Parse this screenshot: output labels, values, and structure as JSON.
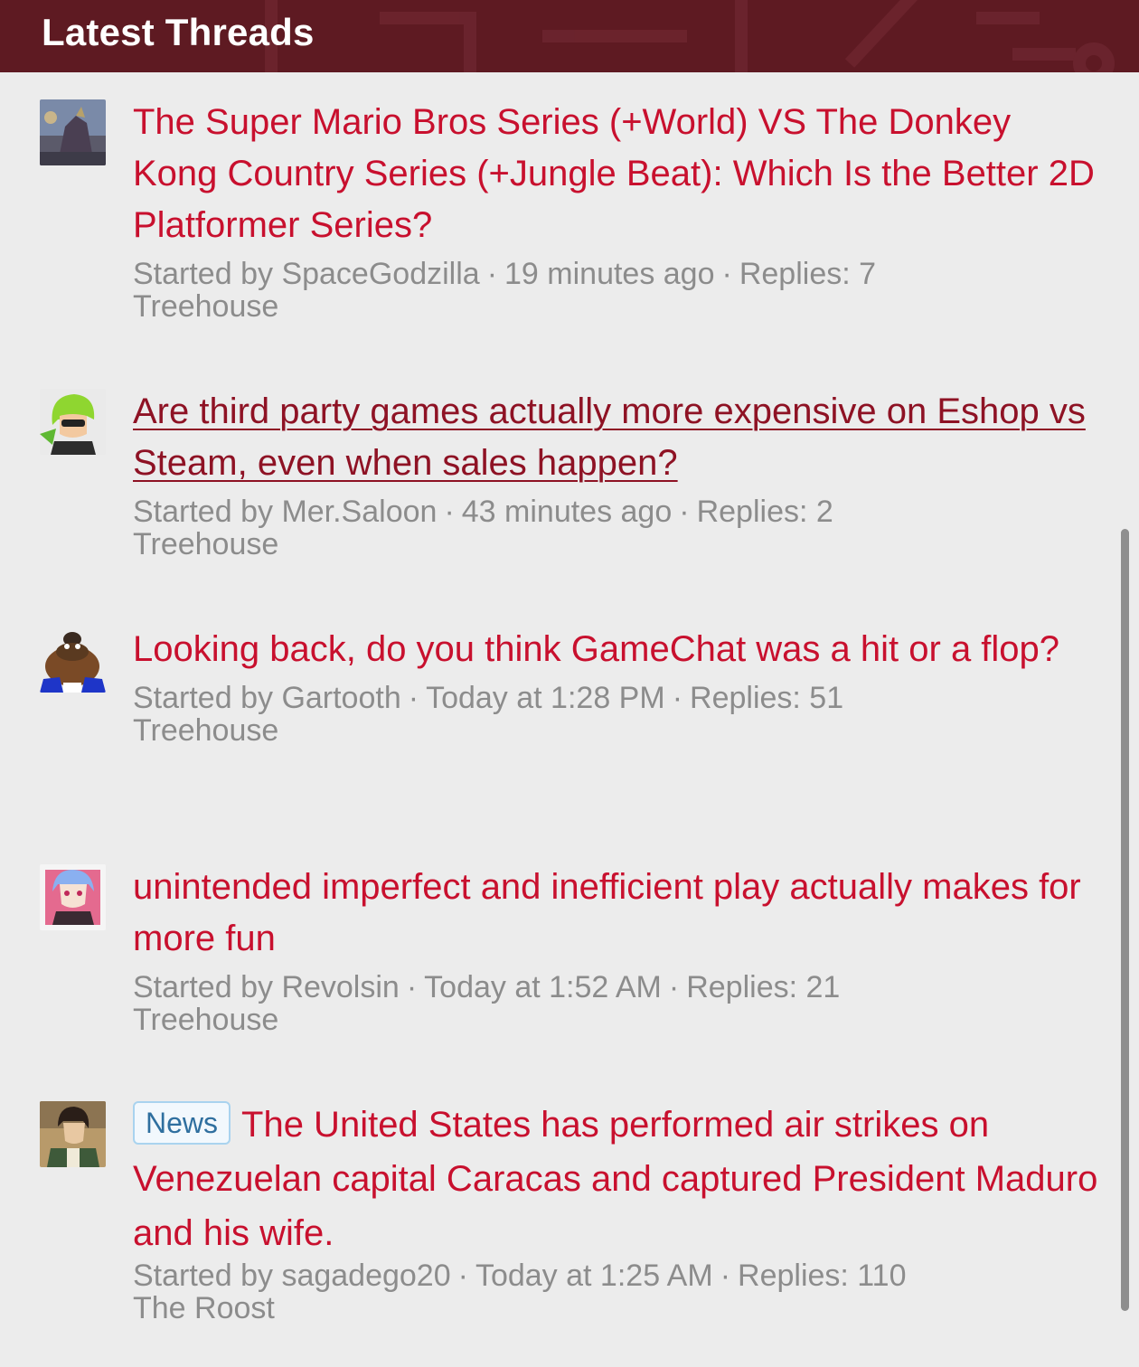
{
  "header": {
    "title": "Latest Threads"
  },
  "threads": [
    {
      "title": "The Super Mario Bros Series (+World) VS The Donkey Kong Country Series (+Jungle Beat): Which Is the Better 2D Platformer Series?",
      "started_by_prefix": "Started by",
      "author": "SpaceGodzilla",
      "time": "19 minutes ago",
      "replies": "Replies: 7",
      "forum": "Treehouse",
      "avatar": "avatar-spacegodzilla"
    },
    {
      "title": "Are third party games actually more expensive on Eshop vs Steam, even when sales happen?",
      "started_by_prefix": "Started by",
      "author": "Mer.Saloon",
      "time": "43 minutes ago",
      "replies": "Replies: 2",
      "forum": "Treehouse",
      "avatar": "avatar-mer-saloon"
    },
    {
      "title": "Looking back, do you think GameChat was a hit or a flop?",
      "started_by_prefix": "Started by",
      "author": "Gartooth",
      "time": "Today at 1:28 PM",
      "replies": "Replies: 51",
      "forum": "Treehouse",
      "avatar": "avatar-gartooth"
    },
    {
      "title": "unintended imperfect and inefficient play actually makes for more fun",
      "started_by_prefix": "Started by",
      "author": "Revolsin",
      "time": "Today at 1:52 AM",
      "replies": "Replies: 21",
      "forum": "Treehouse",
      "avatar": "avatar-revolsin"
    },
    {
      "prefix": "News",
      "title": "The United States has performed air strikes on Venezuelan capital Caracas and captured President Maduro and his wife.",
      "started_by_prefix": "Started by",
      "author": "sagadego20",
      "time": "Today at 1:25 AM",
      "replies": "Replies: 110",
      "forum": "The Roost",
      "avatar": "avatar-sagadego20"
    }
  ],
  "colors": {
    "header_bg": "#5e1a22",
    "link": "#c8102e",
    "link_hover": "#8e1224",
    "meta": "#8c8c8c",
    "background": "#ececec"
  }
}
